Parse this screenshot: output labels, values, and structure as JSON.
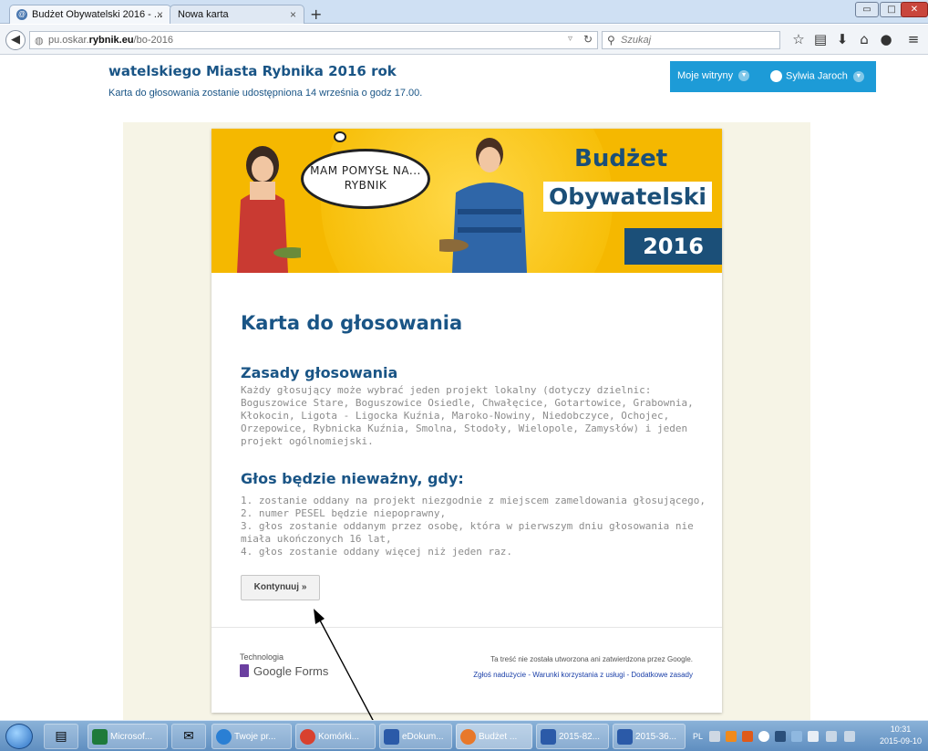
{
  "browser": {
    "tabs": [
      {
        "title": "Budżet Obywatelski 2016 - ...",
        "close": "×"
      },
      {
        "title": "Nowa karta",
        "close": "×"
      }
    ],
    "new_tab": "+",
    "window_buttons": {
      "minimize": "▭",
      "maximize": "□",
      "close": "✕"
    },
    "url_prefix": "pu.oskar.",
    "url_domain": "rybnik.eu",
    "url_path": "/bo-2016",
    "search_placeholder": "Szukaj",
    "toolbar_icons": [
      "star-icon",
      "reading-list-icon",
      "download-icon",
      "home-icon",
      "chat-icon",
      "menu-icon"
    ]
  },
  "site": {
    "title": "watelskiego Miasta Rybnika 2016 rok",
    "subtitle": "Karta do głosowania zostanie udostępniona  14 września o godz 17.00.",
    "sites_menu": "Moje witryny",
    "user_name": "Sylwia Jaroch",
    "accent_color": "#1d9bd7"
  },
  "banner": {
    "bubble_line1": "MAM POMYSŁ NA...",
    "bubble_line2": "RYBNIK",
    "brand_line1": "Budżet",
    "brand_line2": "Obywatelski",
    "brand_year": "2016",
    "bg_color": "#f5b800"
  },
  "form": {
    "title": "Karta do głosowania",
    "rules_heading": "Zasady głosowania",
    "rules_text": "Każdy głosujący może wybrać jeden projekt lokalny (dotyczy dzielnic: Boguszowice Stare, Boguszowice Osiedle, Chwałęcice, Gotartowice, Grabownia, Kłokocin, Ligota - Ligocka Kuźnia, Maroko-Nowiny, Niedobczyce, Ochojec, Orzepowice, Rybnicka Kuźnia, Smolna, Stodoły, Wielopole, Zamysłów) i jeden projekt ogólnomiejski.",
    "invalid_heading": "Głos będzie nieważny, gdy:",
    "invalid_items": [
      "1. zostanie oddany na projekt niezgodnie z miejscem zameldowania głosującego,",
      "2. numer PESEL będzie niepoprawny,",
      "3. głos zostanie oddanym przez osobę, która w pierwszym dniu głosowania nie miała ukończonych 16 lat,",
      "4. głos zostanie oddany więcej niż jeden raz."
    ],
    "continue_label": "Kontynuuj »",
    "tech_label": "Technologia",
    "gforms_label": "Google Forms",
    "disclaimer": "Ta treść nie została utworzona ani zatwierdzona przez Google.",
    "footer_links": "Zgłoś nadużycie - Warunki korzystania z usługi - Dodatkowe zasady"
  },
  "taskbar": {
    "items": [
      "Microsof...",
      "Twoje pr...",
      "Komórki...",
      "eDokum...",
      "Budżet ...",
      "2015-82...",
      "2015-36..."
    ],
    "language": "PL",
    "time": "10:31",
    "date": "2015-09-10"
  }
}
